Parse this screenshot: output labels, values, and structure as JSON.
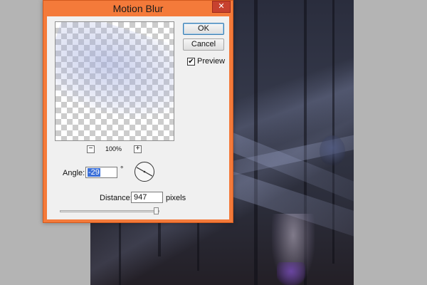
{
  "dialog": {
    "title": "Motion Blur",
    "close_glyph": "✕",
    "ok_label": "OK",
    "cancel_label": "Cancel",
    "preview_label": "Preview",
    "preview_checked": true,
    "zoom_out_glyph": "−",
    "zoom_in_glyph": "+",
    "zoom_level": "100%",
    "angle": {
      "label": "Angle:",
      "value": "-29",
      "unit": "°",
      "degrees": -29
    },
    "distance": {
      "label": "Distance:",
      "value": "947",
      "unit": "pixels",
      "slider_fraction": 0.97
    }
  },
  "colors": {
    "dialog_frame": "#f47a3a",
    "close_button": "#c7412f",
    "selection": "#3a6fd8"
  },
  "icons": {
    "close": "close-icon",
    "angle_dial": "angle-dial-icon",
    "checkbox": "checkmark-icon"
  }
}
